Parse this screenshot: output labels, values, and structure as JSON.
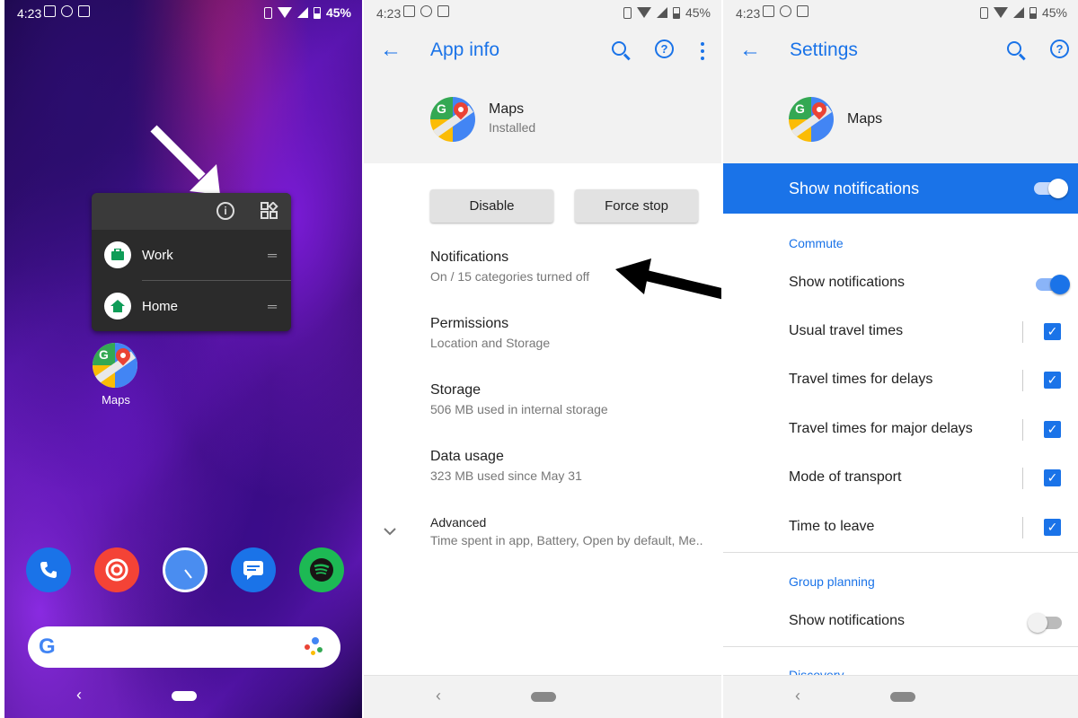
{
  "status": {
    "time": "4:23",
    "battery": "45%"
  },
  "launcher": {
    "popup": {
      "items": [
        {
          "label": "Work"
        },
        {
          "label": "Home"
        }
      ]
    },
    "app_label": "Maps",
    "dock_apps": [
      "phone-icon",
      "pocket-casts-icon",
      "clock-icon",
      "messages-icon",
      "spotify-icon"
    ],
    "search_logo": "G"
  },
  "app_info": {
    "title": "App info",
    "app_name": "Maps",
    "app_status": "Installed",
    "disable_label": "Disable",
    "force_stop_label": "Force stop",
    "items": [
      {
        "title": "Notifications",
        "subtitle": "On / 15 categories turned off"
      },
      {
        "title": "Permissions",
        "subtitle": "Location and Storage"
      },
      {
        "title": "Storage",
        "subtitle": "506 MB used in internal storage"
      },
      {
        "title": "Data usage",
        "subtitle": "323 MB used since May 31"
      },
      {
        "title": "Advanced",
        "subtitle": "Time spent in app, Battery, Open by default, Me.."
      }
    ]
  },
  "settings": {
    "title": "Settings",
    "app_name": "Maps",
    "master_toggle_label": "Show notifications",
    "section_commute": "Commute",
    "commute_items": [
      {
        "label": "Show notifications",
        "control": "toggle-on"
      },
      {
        "label": "Usual travel times",
        "control": "checkbox"
      },
      {
        "label": "Travel times for delays",
        "control": "checkbox"
      },
      {
        "label": "Travel times for major delays",
        "control": "checkbox"
      },
      {
        "label": "Mode of transport",
        "control": "checkbox"
      },
      {
        "label": "Time to leave",
        "control": "checkbox"
      }
    ],
    "section_group": "Group planning",
    "group_item": {
      "label": "Show notifications",
      "control": "toggle-off"
    },
    "section_discovery": "Discovery"
  },
  "colors": {
    "accent": "#1a73e8",
    "appbar_bg": "#f2f2f2"
  }
}
